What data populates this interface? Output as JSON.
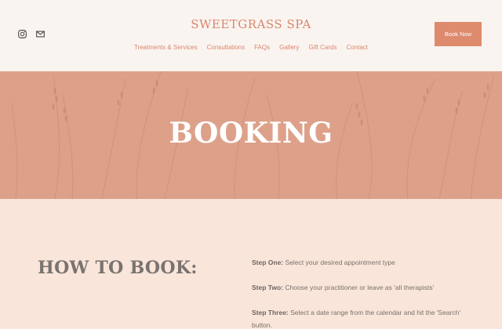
{
  "brand": "SWEETGRASS SPA",
  "social": [
    {
      "icon": "instagram-icon"
    },
    {
      "icon": "email-icon"
    }
  ],
  "nav": [
    "Treatments & Services",
    "Consultations",
    "FAQs",
    "Gallery",
    "Gift Cards",
    "Contact"
  ],
  "book_button": "Book Now",
  "hero": {
    "title": "BOOKING"
  },
  "content": {
    "heading": "HOW TO BOOK:",
    "steps": [
      {
        "label": "Step One:",
        "text": "Select your desired appointment type"
      },
      {
        "label": "Step Two:",
        "text": "Choose your practitioner or leave as 'all therapists'"
      },
      {
        "label": "Step Three:",
        "text": "Select a date range from the calendar and hit the 'Search' button."
      }
    ]
  },
  "colors": {
    "accent": "#dd8a6d",
    "hero_bg": "#dda18a",
    "content_bg": "#f9e5da",
    "header_bg": "#faf4f1"
  }
}
